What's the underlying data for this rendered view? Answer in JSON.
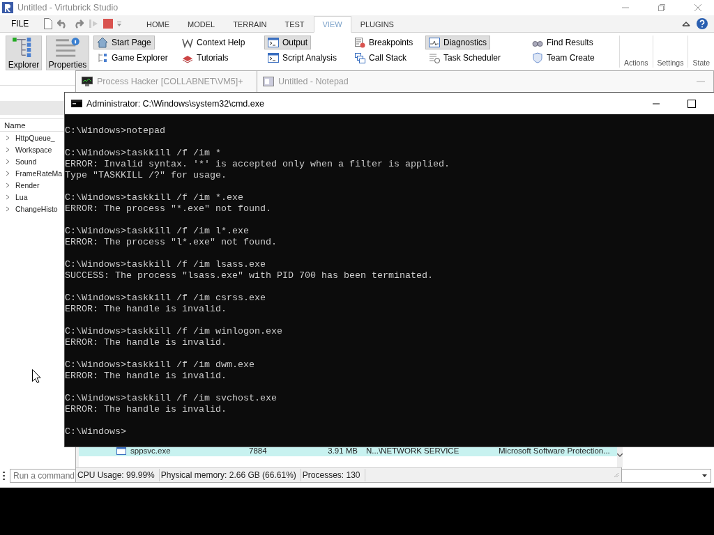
{
  "studio": {
    "title": "Untitled - Virtubrick Studio",
    "file_menu": "FILE",
    "tabs": [
      {
        "label": "HOME",
        "selected": false
      },
      {
        "label": "MODEL",
        "selected": false
      },
      {
        "label": "TERRAIN",
        "selected": false
      },
      {
        "label": "TEST",
        "selected": false
      },
      {
        "label": "VIEW",
        "selected": true
      },
      {
        "label": "PLUGINS",
        "selected": false
      }
    ],
    "big_buttons": [
      {
        "label": "Explorer",
        "selected": true
      },
      {
        "label": "Properties",
        "selected": true
      }
    ],
    "ribbon_columns": [
      [
        {
          "label": "Start Page",
          "selected": true
        },
        {
          "label": "Game Explorer",
          "selected": false
        }
      ],
      [
        {
          "label": "Context Help",
          "selected": false
        },
        {
          "label": "Tutorials",
          "selected": false
        }
      ],
      [
        {
          "label": "Output",
          "selected": true
        },
        {
          "label": "Script Analysis",
          "selected": false
        }
      ],
      [
        {
          "label": "Breakpoints",
          "selected": false
        },
        {
          "label": "Call Stack",
          "selected": false
        }
      ],
      [
        {
          "label": "Diagnostics",
          "selected": true
        },
        {
          "label": "Task Scheduler",
          "selected": false
        }
      ],
      [
        {
          "label": "Find Results",
          "selected": false
        },
        {
          "label": "Team Create",
          "selected": false
        }
      ]
    ],
    "group_labels": [
      "Actions",
      "Settings",
      "State"
    ],
    "explorer": {
      "column": "Name",
      "items": [
        {
          "label": "HttpQueue_",
          "expanded": false
        },
        {
          "label": "Workspace",
          "expanded": false
        },
        {
          "label": "Sound",
          "expanded": false
        },
        {
          "label": "FrameRateMa",
          "expanded": false
        },
        {
          "label": "Render",
          "expanded": false
        },
        {
          "label": "Lua",
          "expanded": false
        },
        {
          "label": "ChangeHisto",
          "expanded": false
        }
      ]
    },
    "command_bar": {
      "placeholder": "Run a command"
    }
  },
  "process_hacker": {
    "title": "Process Hacker [COLLABNET\\VM5]+",
    "rows": [
      {
        "cells": [
          "sppsvc.exe",
          "7884",
          "3.91 MB",
          "N...\\NETWORK SERVICE",
          "Microsoft Software Protection..."
        ],
        "selected": true
      }
    ],
    "status_bar": [
      "CPU Usage: 99.99%",
      "Physical memory: 2.66 GB (66.61%)",
      "Processes: 130"
    ]
  },
  "notepad": {
    "title": "Untitled - Notepad"
  },
  "cmd": {
    "title": "Administrator: C:\\Windows\\system32\\cmd.exe",
    "blocks": [
      [
        "C:\\Windows>notepad"
      ],
      [
        "C:\\Windows>taskkill /f /im *",
        "ERROR: Invalid syntax. '*' is accepted only when a filter is applied.",
        "Type \"TASKKILL /?\" for usage."
      ],
      [
        "C:\\Windows>taskkill /f /im *.exe",
        "ERROR: The process \"*.exe\" not found."
      ],
      [
        "C:\\Windows>taskkill /f /im l*.exe",
        "ERROR: The process \"l*.exe\" not found."
      ],
      [
        "C:\\Windows>taskkill /f /im lsass.exe",
        "SUCCESS: The process \"lsass.exe\" with PID 700 has been terminated."
      ],
      [
        "C:\\Windows>taskkill /f /im csrss.exe",
        "ERROR: The handle is invalid."
      ],
      [
        "C:\\Windows>taskkill /f /im winlogon.exe",
        "ERROR: The handle is invalid."
      ],
      [
        "C:\\Windows>taskkill /f /im dwm.exe",
        "ERROR: The handle is invalid."
      ],
      [
        "C:\\Windows>taskkill /f /im svchost.exe",
        "ERROR: The handle is invalid."
      ],
      [
        "C:\\Windows>"
      ]
    ]
  }
}
